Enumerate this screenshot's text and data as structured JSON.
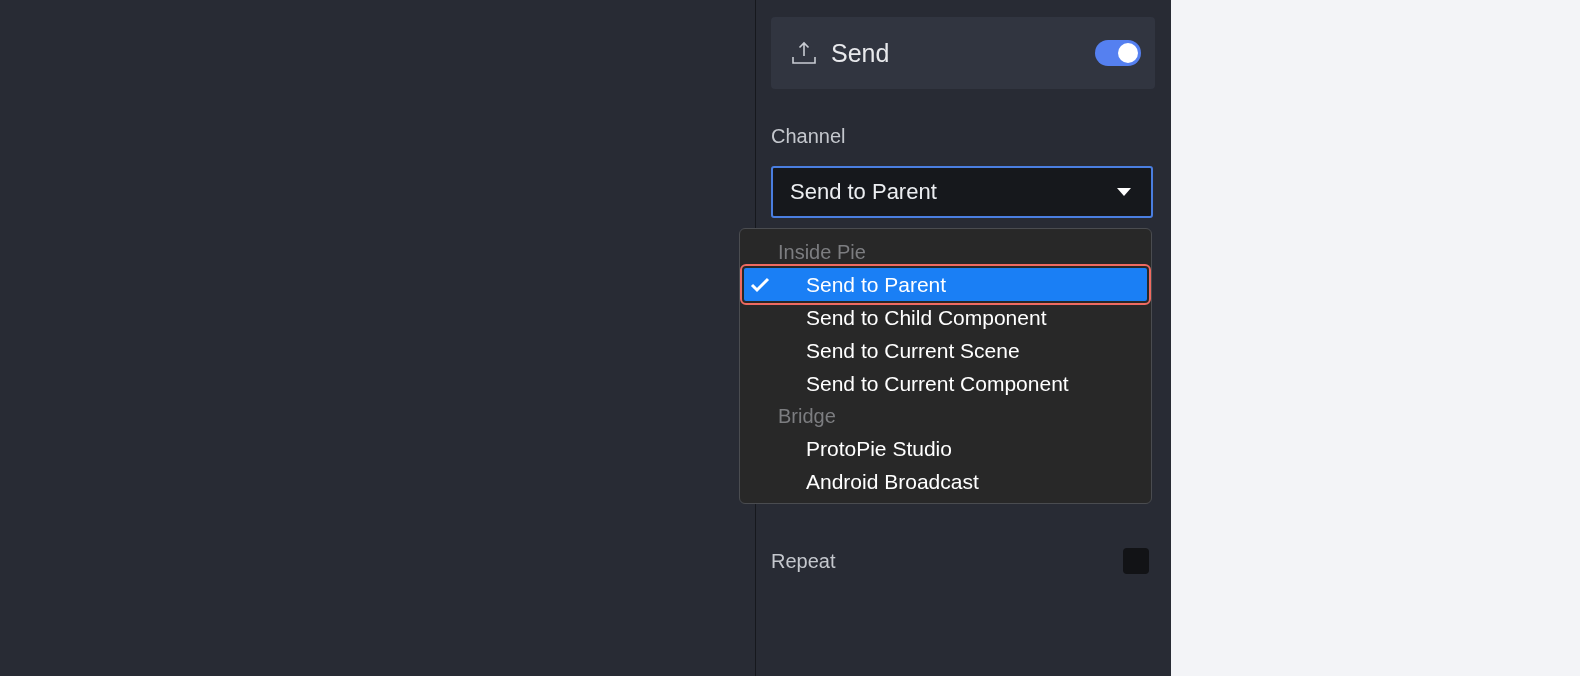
{
  "send": {
    "title": "Send",
    "on": true
  },
  "channel": {
    "label": "Channel",
    "value": "Send to Parent"
  },
  "menu": {
    "groups": [
      {
        "label": "Inside Pie",
        "items": [
          {
            "label": "Send to Parent",
            "selected": true
          },
          {
            "label": "Send to Child Component",
            "selected": false
          },
          {
            "label": "Send to Current Scene",
            "selected": false
          },
          {
            "label": "Send to Current Component",
            "selected": false
          }
        ]
      },
      {
        "label": "Bridge",
        "items": [
          {
            "label": "ProtoPie Studio",
            "selected": false
          },
          {
            "label": "Android Broadcast",
            "selected": false
          }
        ]
      }
    ]
  },
  "repeat": {
    "label": "Repeat",
    "checked": false
  }
}
